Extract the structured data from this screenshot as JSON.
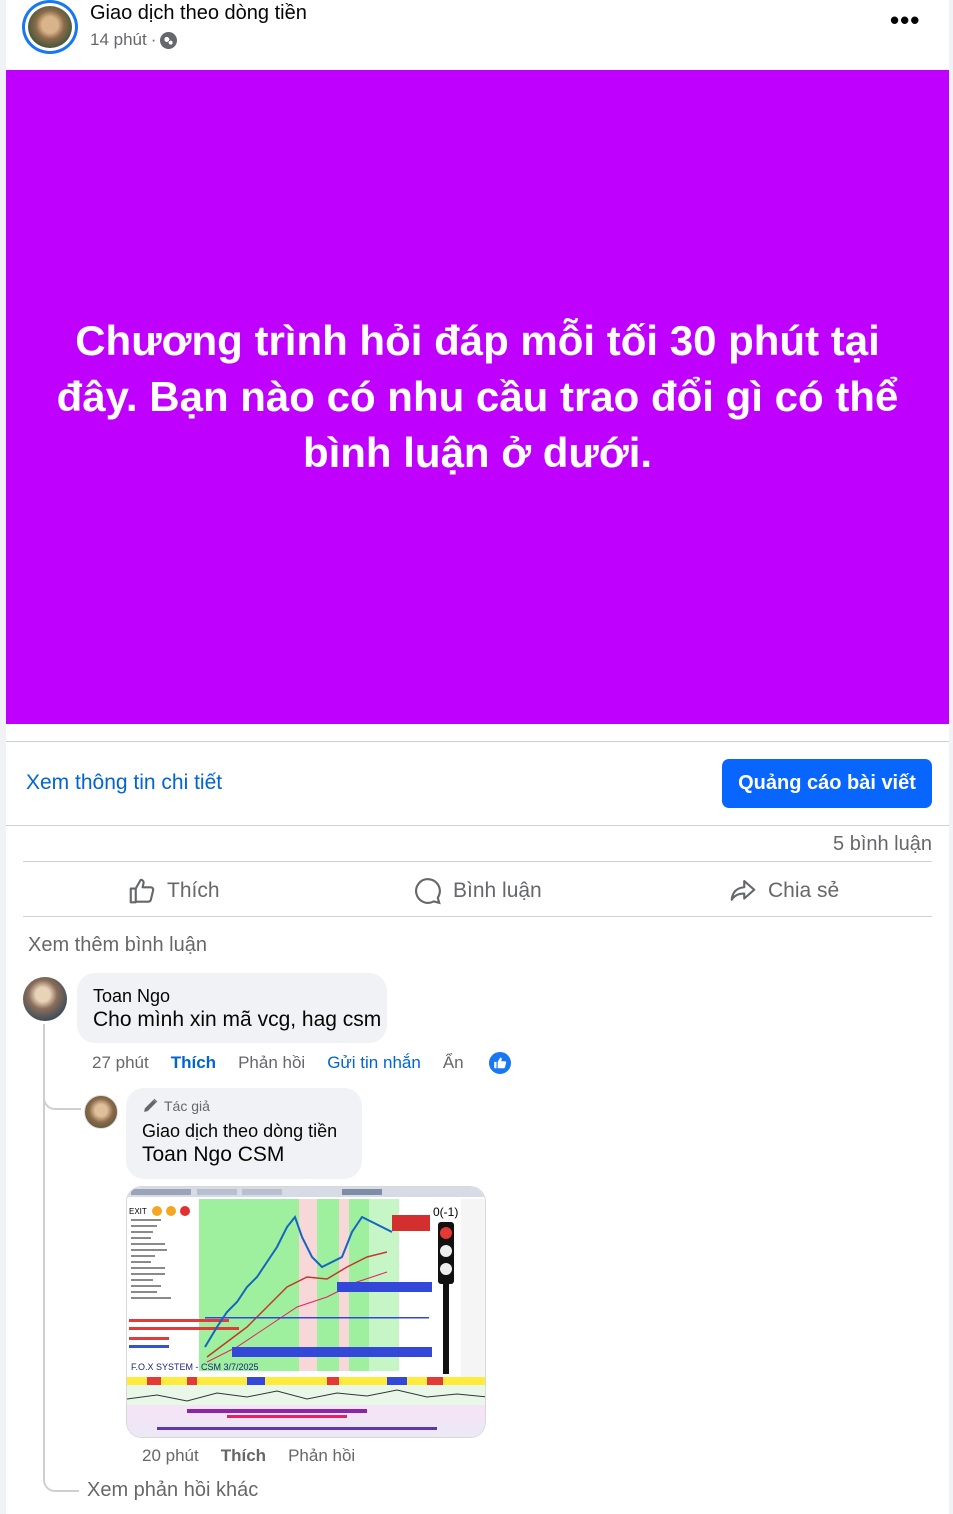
{
  "post": {
    "page_name": "Giao dịch theo dòng tiền",
    "time": "14 phút",
    "separator": "·",
    "privacy_icon": "globe-icon",
    "more_icon": "more-horizontal-icon",
    "more_glyph": "•••",
    "banner_text": "Chương trình hỏi đáp mỗi tối 30 phút tại đây. Bạn nào có nhu cầu trao đổi gì có thể bình luận ở dưới.",
    "banner_color": "#bf00fe"
  },
  "promo": {
    "detail_link": "Xem thông tin chi tiết",
    "boost_button": "Quảng cáo bài viết"
  },
  "stats": {
    "comment_count": "5 bình luận"
  },
  "actions": {
    "like": "Thích",
    "comment": "Bình luận",
    "share": "Chia sẻ"
  },
  "comments": {
    "see_more": "Xem thêm bình luận",
    "items": [
      {
        "author": "Toan Ngo",
        "text": "Cho mình xin mã vcg, hag csm",
        "time": "27 phút",
        "like": "Thích",
        "reply": "Phản hồi",
        "message": "Gửi tin nhắn",
        "hide": "Ẩn",
        "reaction_icon": "like-reaction-icon"
      }
    ],
    "reply": {
      "badge": "Tác giả",
      "author": "Giao dịch theo dòng tiền",
      "mention": "Toan Ngo",
      "text": "CSM",
      "time": "20 phút",
      "like": "Thích",
      "reply": "Phản hồi",
      "chart_label": "F.O.X SYSTEM - CSM 3/7/2025",
      "chart_signal": "0(-1)",
      "chart_exit": "EXIT"
    },
    "more_replies": "Xem phản hồi khác"
  },
  "colors": {
    "accent": "#0866ff",
    "link": "#0064d1",
    "muted": "#65676b"
  }
}
